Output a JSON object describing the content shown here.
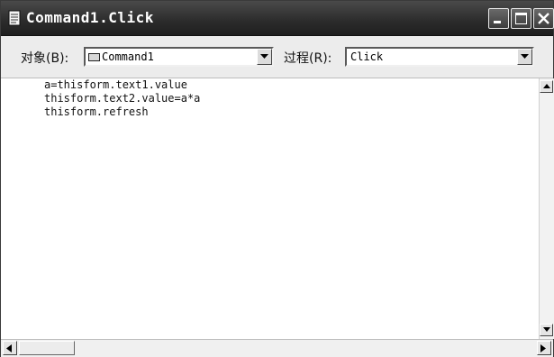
{
  "window": {
    "title": "Command1.Click"
  },
  "toolbar": {
    "object_label": "对象(B):",
    "object_value": "Command1",
    "procedure_label": "过程(R):",
    "procedure_value": "Click"
  },
  "code": {
    "lines": [
      "a=thisform.text1.value",
      "thisform.text2.value=a*a",
      "thisform.refresh"
    ]
  },
  "icons": {
    "title": "code-window-icon",
    "minimize": "minimize-icon",
    "maximize": "maximize-icon",
    "close": "close-icon",
    "dropdown": "chevron-down-icon",
    "command": "command-button-icon"
  }
}
